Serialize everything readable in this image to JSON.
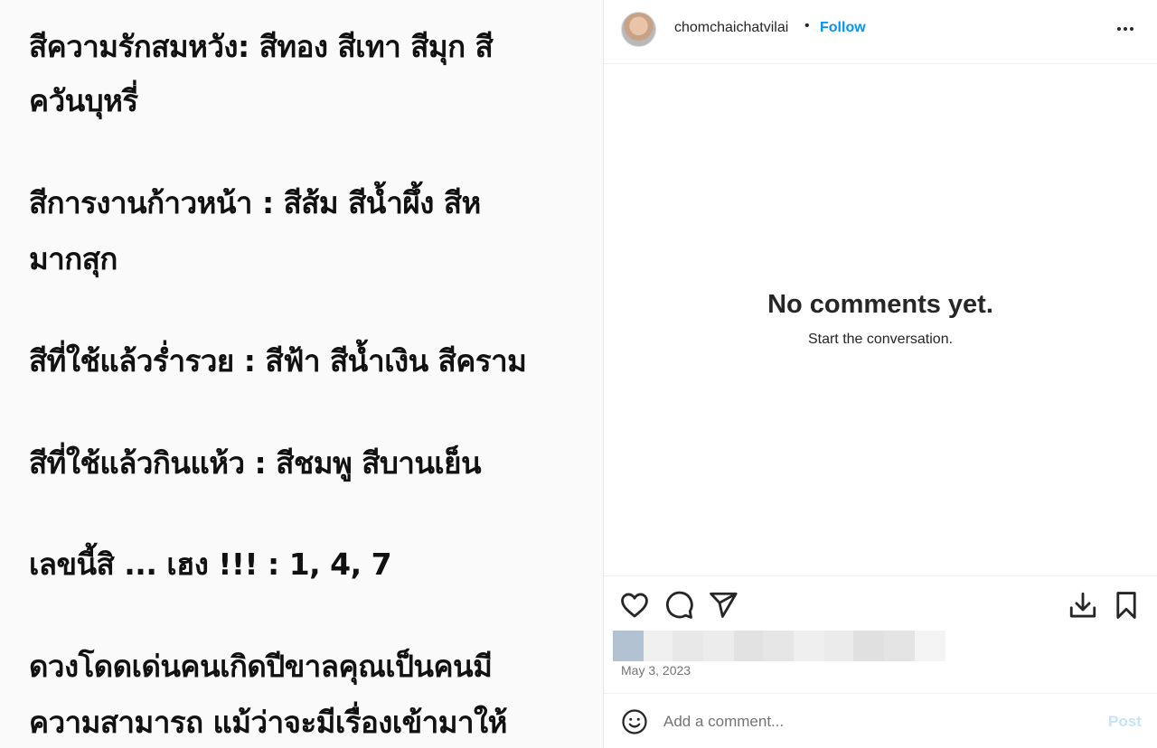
{
  "post_image": {
    "lines": [
      "สีความรักสมหวัง: สีทอง สีเทา สีมุก สี",
      "ควันบุหรี่",
      "สีการงานก้าวหน้า : สีส้ม สีน้ำผึ้ง สีห",
      "มากสุก",
      "สีที่ใช้แล้วร่ำรวย : สีฟ้า สีน้ำเงิน สีคราม",
      "สีที่ใช้แล้วกินแห้ว : สีชมพู สีบานเย็น",
      "เลขนี้สิ ... เฮง !!! : 1, 4, 7",
      "ดวงโดดเด่นคนเกิดปีขาลคุณเป็นคนมี",
      "ความสามารถ แม้ว่าจะมีเรื่องเข้ามาให้"
    ]
  },
  "header": {
    "username": "chomchaichatvilai",
    "separator": "•",
    "follow_label": "Follow"
  },
  "comments": {
    "empty_title": "No comments yet.",
    "empty_subtitle": "Start the conversation."
  },
  "actions": {
    "date": "May 3, 2023"
  },
  "comment_bar": {
    "placeholder": "Add a comment...",
    "post_label": "Post"
  },
  "colors": {
    "link": "#0095f6",
    "post_disabled": "#c6e3fb",
    "text": "#262626",
    "muted": "#737373"
  },
  "icons": [
    "like-heart-icon",
    "comment-bubble-icon",
    "share-send-icon",
    "download-icon",
    "bookmark-icon",
    "emoji-icon",
    "more-options-icon"
  ]
}
